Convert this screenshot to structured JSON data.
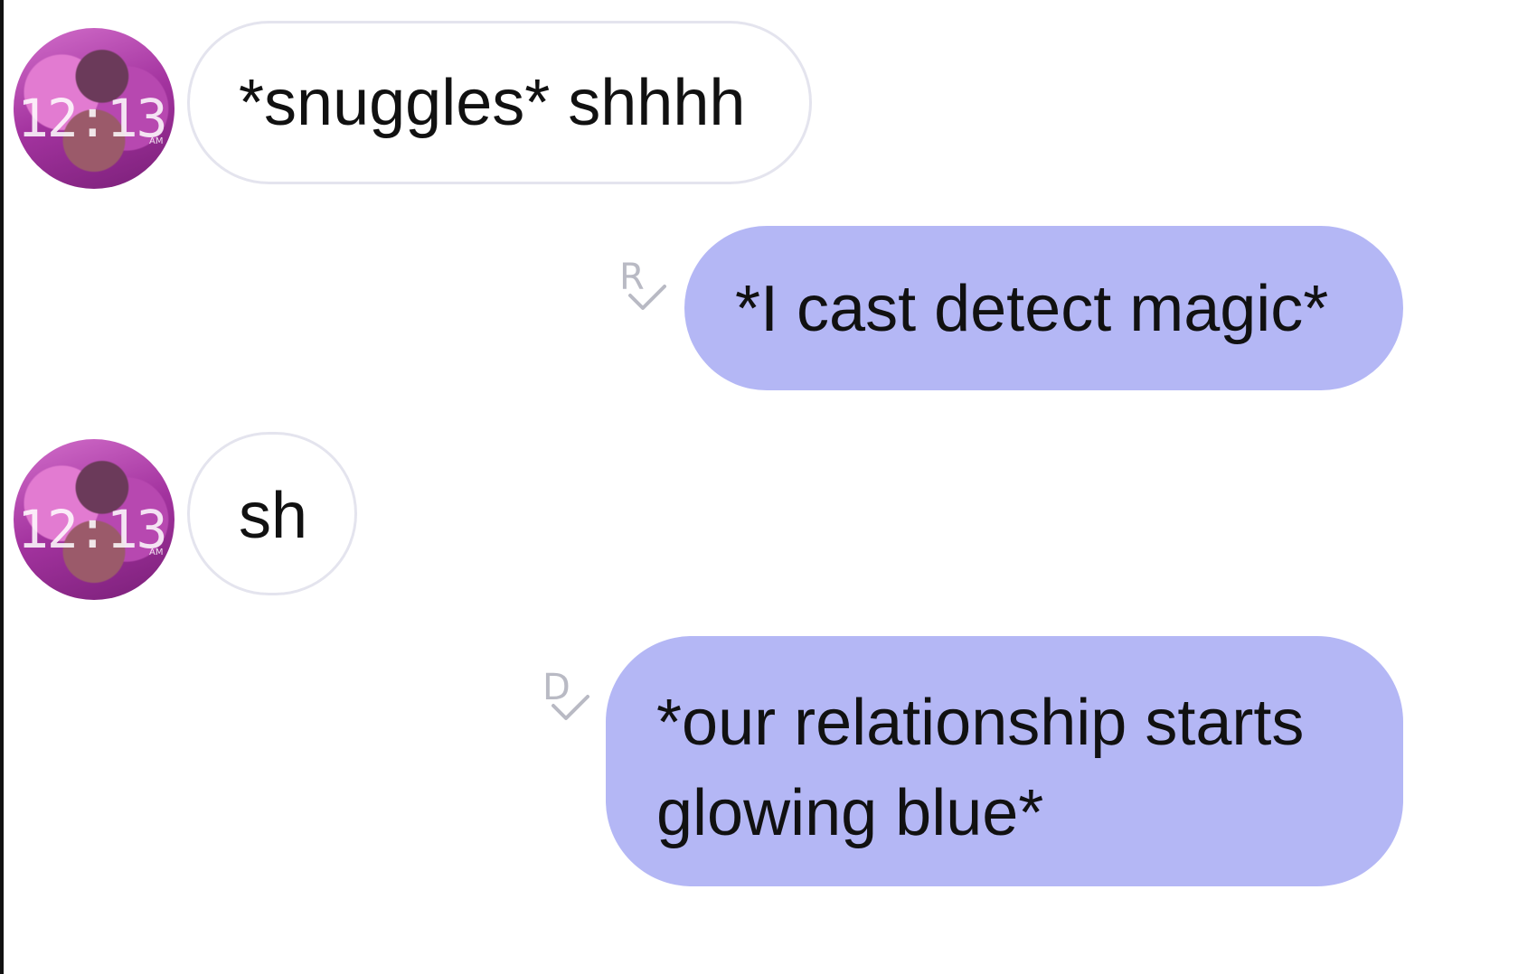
{
  "messages": [
    {
      "direction": "incoming",
      "text": "*snuggles* shhhh",
      "avatar": {
        "clock": "12:13",
        "ampm": "AM"
      }
    },
    {
      "direction": "outgoing",
      "text": "*I cast detect magic*",
      "receipt": "R"
    },
    {
      "direction": "incoming",
      "text": "sh",
      "avatar": {
        "clock": "12:13",
        "ampm": "AM"
      }
    },
    {
      "direction": "outgoing",
      "lines": [
        "*our relationship starts",
        "glowing blue*"
      ],
      "receipt": "D"
    }
  ],
  "colors": {
    "outgoing_bubble": "#b4b7f5",
    "incoming_border": "#e4e4ee",
    "receipt": "#b9bac4"
  },
  "icons": {
    "receipt_check": "checkmark-icon",
    "avatar": "contact-avatar-photo"
  }
}
